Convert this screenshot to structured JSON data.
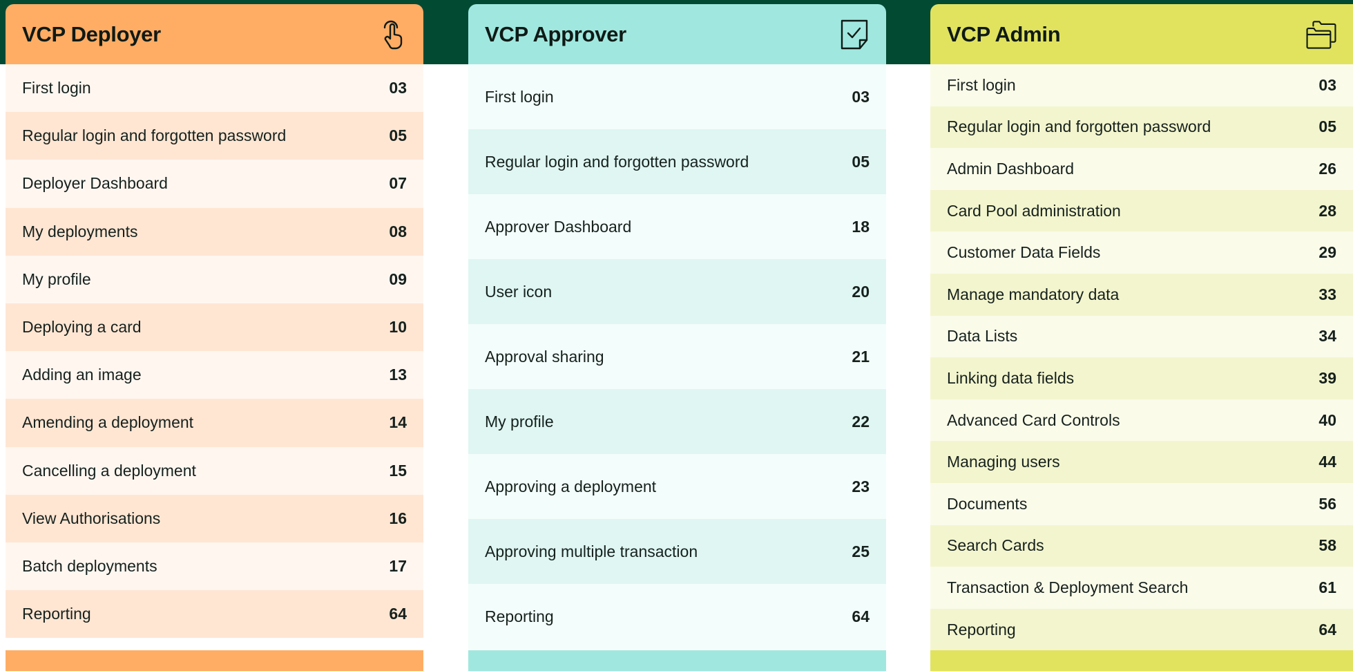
{
  "colors": {
    "top_band": "#034a33",
    "deployer_accent": "#ffad64",
    "approver_accent": "#a0e8df",
    "admin_accent": "#e1e35f"
  },
  "deployer": {
    "title": "VCP Deployer",
    "icon": "touch-hand-icon",
    "rows": [
      {
        "label": "First login",
        "page": "03"
      },
      {
        "label": "Regular login and forgotten password",
        "page": "05"
      },
      {
        "label": "Deployer Dashboard",
        "page": "07"
      },
      {
        "label": "My deployments",
        "page": "08"
      },
      {
        "label": "My profile",
        "page": "09"
      },
      {
        "label": "Deploying a card",
        "page": "10"
      },
      {
        "label": "Adding an image",
        "page": "13"
      },
      {
        "label": "Amending a deployment",
        "page": "14"
      },
      {
        "label": "Cancelling a deployment",
        "page": "15"
      },
      {
        "label": "View Authorisations",
        "page": "16"
      },
      {
        "label": "Batch deployments",
        "page": "17"
      },
      {
        "label": "Reporting",
        "page": "64"
      }
    ]
  },
  "approver": {
    "title": "VCP Approver",
    "icon": "document-check-icon",
    "rows": [
      {
        "label": "First login",
        "page": "03"
      },
      {
        "label": "Regular login and forgotten password",
        "page": "05"
      },
      {
        "label": "Approver Dashboard",
        "page": "18"
      },
      {
        "label": "User icon",
        "page": "20"
      },
      {
        "label": "Approval sharing",
        "page": "21"
      },
      {
        "label": "My profile",
        "page": "22"
      },
      {
        "label": "Approving a deployment",
        "page": "23"
      },
      {
        "label": "Approving multiple transaction",
        "page": "25"
      },
      {
        "label": "Reporting",
        "page": "64"
      }
    ]
  },
  "admin": {
    "title": "VCP Admin",
    "icon": "folders-icon",
    "rows": [
      {
        "label": "First login",
        "page": "03"
      },
      {
        "label": "Regular login and forgotten password",
        "page": "05"
      },
      {
        "label": "Admin Dashboard",
        "page": "26"
      },
      {
        "label": "Card Pool administration",
        "page": "28"
      },
      {
        "label": "Customer Data Fields",
        "page": "29"
      },
      {
        "label": "Manage mandatory data",
        "page": "33"
      },
      {
        "label": "Data Lists",
        "page": "34"
      },
      {
        "label": "Linking data fields",
        "page": "39"
      },
      {
        "label": "Advanced Card Controls",
        "page": "40"
      },
      {
        "label": "Managing users",
        "page": "44"
      },
      {
        "label": "Documents",
        "page": "56"
      },
      {
        "label": "Search Cards",
        "page": "58"
      },
      {
        "label": "Transaction & Deployment Search",
        "page": "61"
      },
      {
        "label": "Reporting",
        "page": "64"
      }
    ]
  }
}
